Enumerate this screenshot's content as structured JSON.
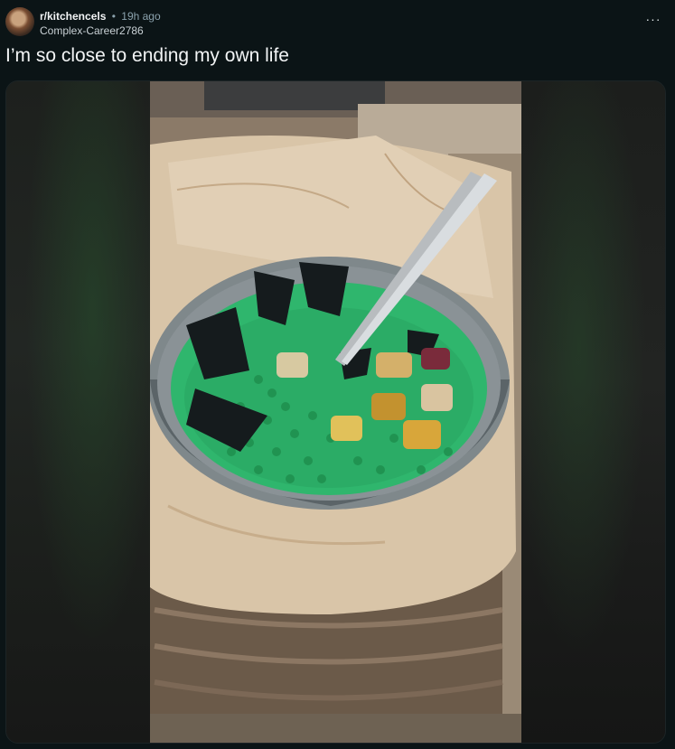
{
  "post": {
    "subreddit": "r/kitchencels",
    "separator": "•",
    "time_ago": "19h ago",
    "author": "Complex-Career2786",
    "title": "I’m so close to ending my own life",
    "more_label": "···"
  },
  "media": {
    "subject": "bowl-of-green-dessert-photo",
    "colors": {
      "soup": "#2fb66d",
      "bowl": "#6d7478",
      "marble": "#d8c3a6",
      "jelly": "#141a1c"
    }
  }
}
